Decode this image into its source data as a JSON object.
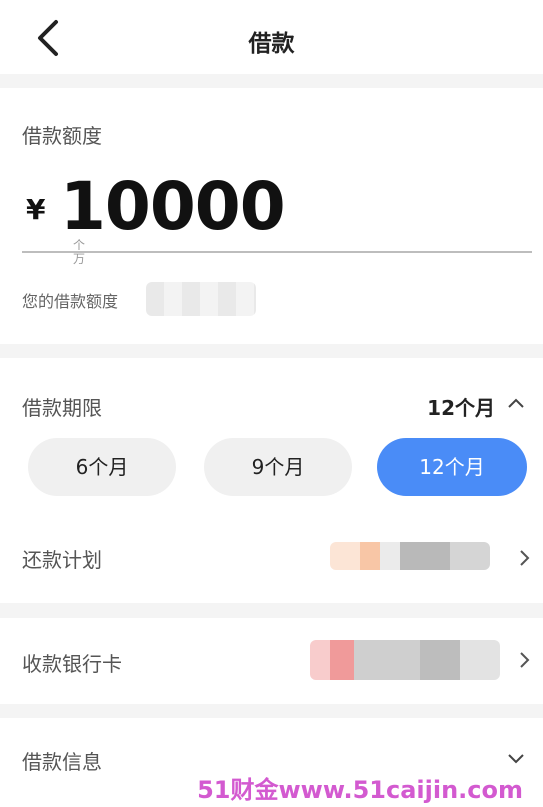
{
  "header": {
    "title": "借款"
  },
  "amount": {
    "label": "借款额度",
    "currency": "¥",
    "value": "10000",
    "unit_mark": "个万",
    "limit_text": "您的借款额度"
  },
  "term": {
    "label": "借款期限",
    "selected": "12个月",
    "options": [
      "6个月",
      "9个月",
      "12个月"
    ]
  },
  "repayment_plan": {
    "label": "还款计划"
  },
  "bank_card": {
    "label": "收款银行卡"
  },
  "loan_info": {
    "label": "借款信息"
  },
  "watermark": "51财金www.51caijin.com",
  "colors": {
    "accent": "#4a8cf7",
    "watermark": "#d35ad0"
  }
}
